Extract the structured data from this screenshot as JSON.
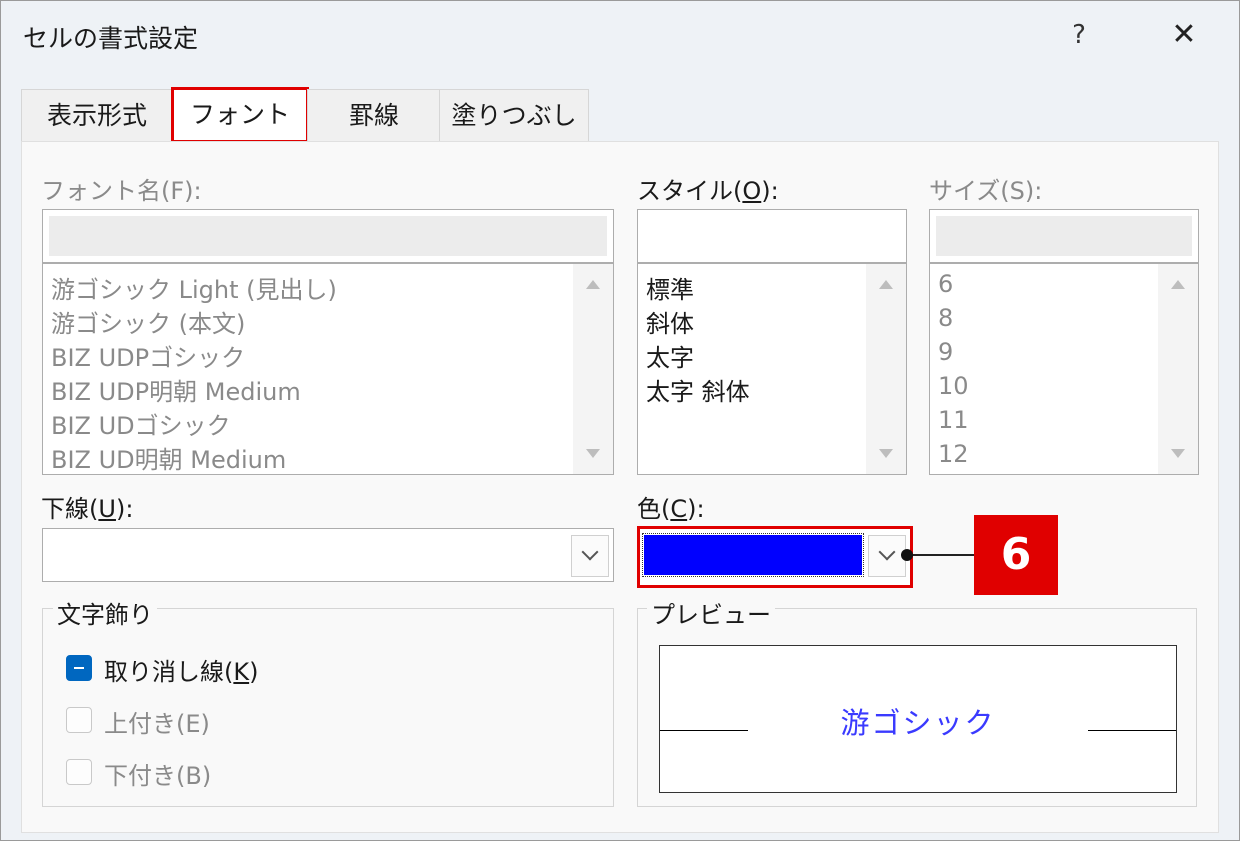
{
  "dialog": {
    "title": "セルの書式設定",
    "help_label": "?",
    "close_label": "✕"
  },
  "tabs": [
    {
      "label": "表示形式"
    },
    {
      "label": "フォント"
    },
    {
      "label": "罫線"
    },
    {
      "label": "塗りつぶし"
    }
  ],
  "font": {
    "label": "フォント名(F):",
    "value": "",
    "items": [
      "游ゴシック Light (見出し)",
      "游ゴシック (本文)",
      "BIZ UDPゴシック",
      "BIZ UDP明朝 Medium",
      "BIZ UDゴシック",
      "BIZ UD明朝 Medium"
    ]
  },
  "style": {
    "label_pre": "スタイル(",
    "label_key": "O",
    "label_post": "):",
    "value": "",
    "items": [
      "標準",
      "斜体",
      "太字",
      "太字 斜体"
    ]
  },
  "size": {
    "label": "サイズ(S):",
    "value": "",
    "items": [
      "6",
      "8",
      "9",
      "10",
      "11",
      "12"
    ]
  },
  "underline": {
    "label_pre": "下線(",
    "label_key": "U",
    "label_post": "):",
    "value": ""
  },
  "color": {
    "label_pre": "色(",
    "label_key": "C",
    "label_post": "):",
    "value_hex": "#0000FF"
  },
  "effects": {
    "title": "文字飾り",
    "strikethrough_pre": "取り消し線(",
    "strikethrough_key": "K",
    "strikethrough_post": ")",
    "strikethrough_state": "indeterminate",
    "superscript": "上付き(E)",
    "subscript": "下付き(B)"
  },
  "preview": {
    "title": "プレビュー",
    "text": "游ゴシック"
  },
  "callout": {
    "number": "6",
    "color": "#E00000"
  }
}
